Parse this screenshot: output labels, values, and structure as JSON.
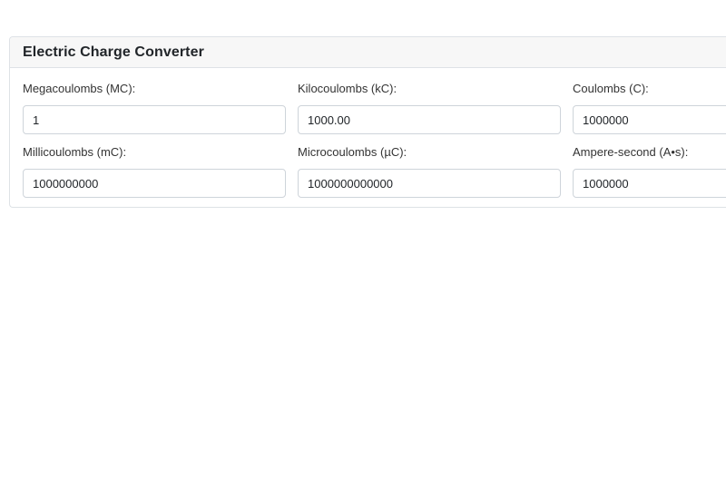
{
  "title": "Electric Charge Converter",
  "fields": [
    {
      "label": "Megacoulombs (MC):",
      "value": "1"
    },
    {
      "label": "Kilocoulombs (kC):",
      "value": "1000.00"
    },
    {
      "label": "Coulombs (C):",
      "value": "1000000"
    },
    {
      "label": "Millicoulombs (mC):",
      "value": "1000000000"
    },
    {
      "label": "Microcoulombs (µC):",
      "value": "1000000000000"
    },
    {
      "label": "Ampere-second (A•s):",
      "value": "1000000"
    }
  ]
}
